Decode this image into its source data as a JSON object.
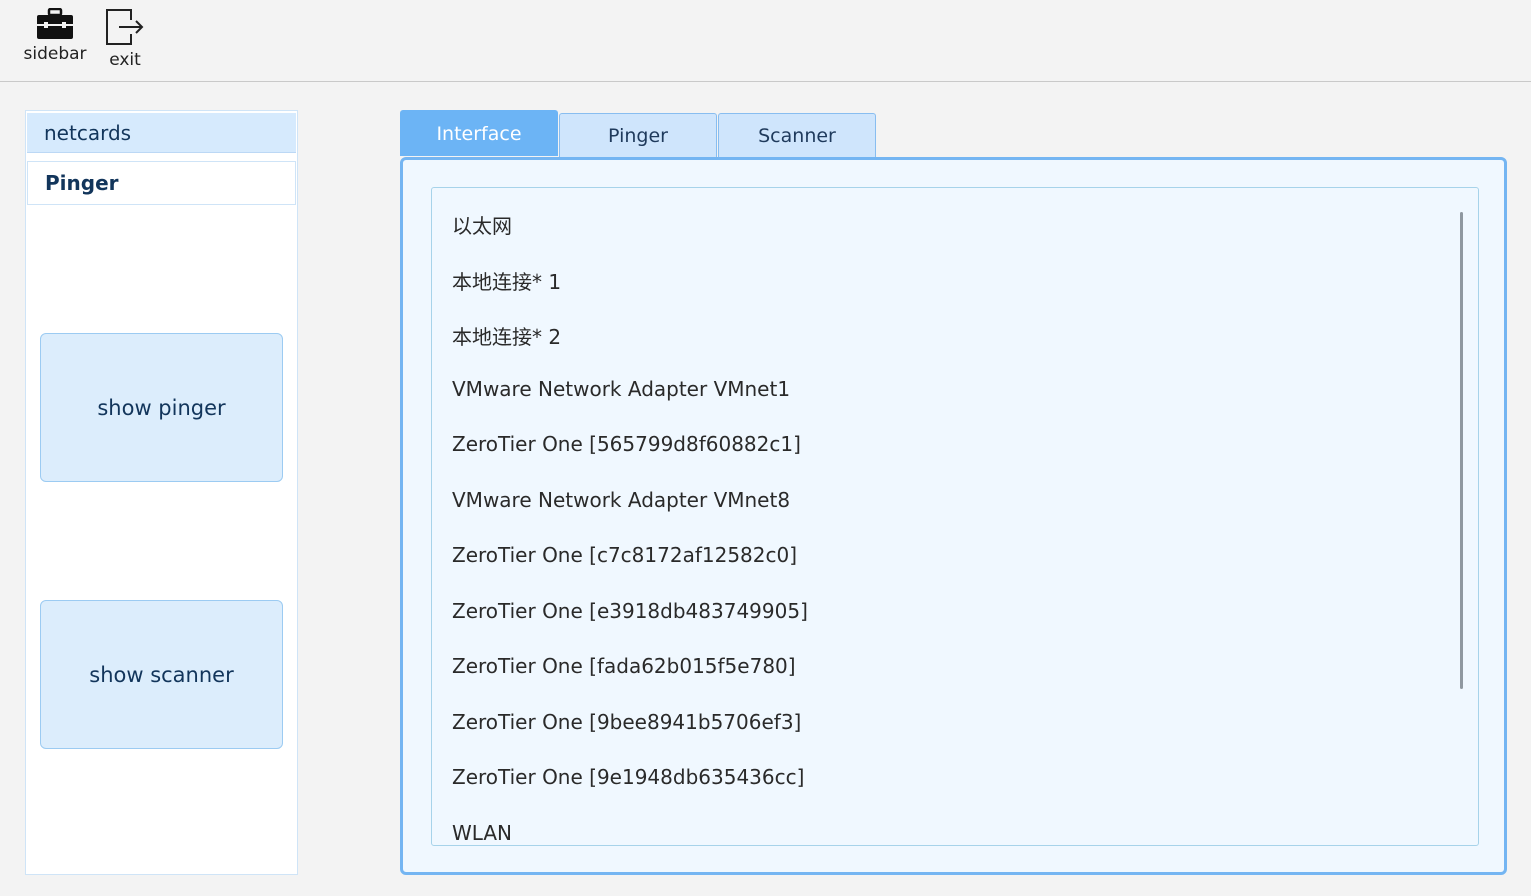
{
  "toolbar": {
    "sidebar_label": "sidebar",
    "sidebar_icon": "briefcase-icon",
    "exit_label": "exit",
    "exit_icon": "exit-icon"
  },
  "sidebar": {
    "tabs": [
      {
        "label": "netcards"
      },
      {
        "label": "Pinger"
      }
    ],
    "buttons": [
      {
        "label": "show pinger"
      },
      {
        "label": "show scanner"
      }
    ]
  },
  "main": {
    "tabs": [
      {
        "label": "Interface",
        "active": true
      },
      {
        "label": "Pinger",
        "active": false
      },
      {
        "label": "Scanner",
        "active": false
      }
    ],
    "interfaces": [
      "以太网",
      "本地连接* 1",
      "本地连接* 2",
      "VMware Network Adapter VMnet1",
      "ZeroTier One [565799d8f60882c1]",
      "VMware Network Adapter VMnet8",
      "ZeroTier One [c7c8172af12582c0]",
      "ZeroTier One [e3918db483749905]",
      "ZeroTier One [fada62b015f5e780]",
      "ZeroTier One [9bee8941b5706ef3]",
      "ZeroTier One [9e1948db635436cc]",
      "WLAN"
    ]
  },
  "colors": {
    "accent": "#6cb4f5",
    "tab_inactive": "#cfe5fc",
    "panel_bg": "#f0f8ff",
    "button_bg": "#dcedfc"
  }
}
